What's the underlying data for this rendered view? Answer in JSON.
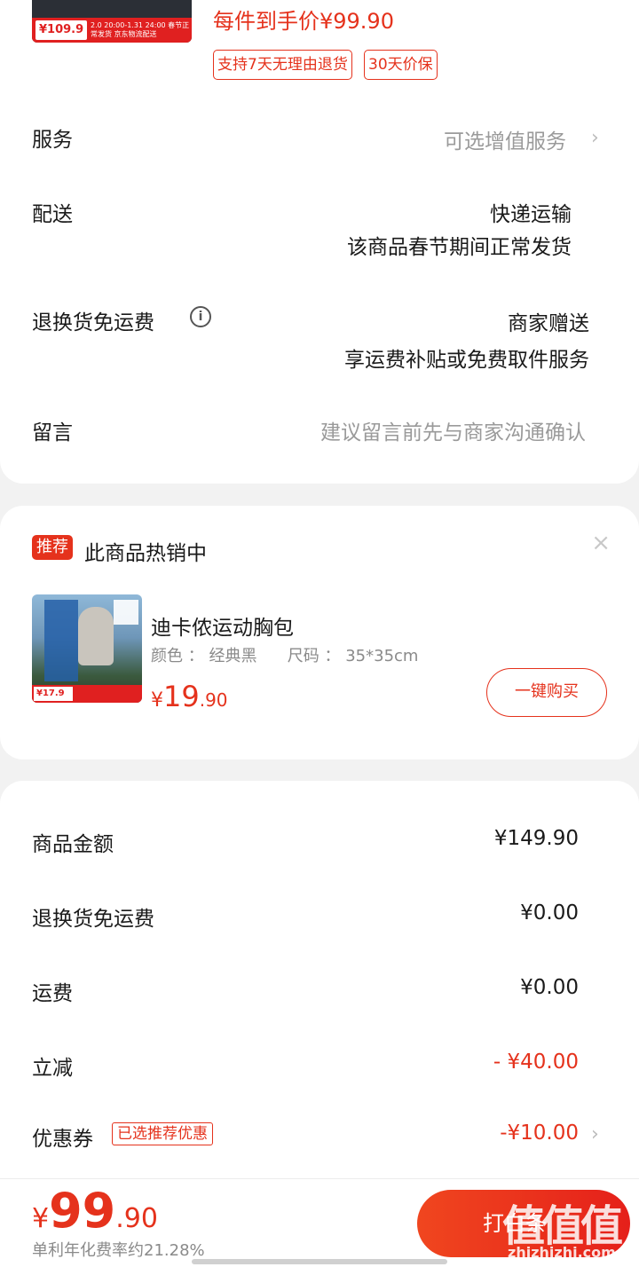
{
  "top": {
    "thumb_price": "109.9",
    "thumb_promo": "2.0 20:00-1.31 24:00 春节正常发货 京东物流配送",
    "unit_price": "每件到手价¥99.90",
    "tags": [
      "支持7天无理由退货",
      "30天价保"
    ]
  },
  "service": {
    "label": "服务",
    "value": "可选增值服务"
  },
  "delivery": {
    "label": "配送",
    "line1": "快递运输",
    "line2": "该商品春节期间正常发货"
  },
  "return_freight": {
    "label": "退换货免运费",
    "info_icon": "i",
    "line1": "商家赠送",
    "line2": "享运费补贴或免费取件服务"
  },
  "message": {
    "label": "留言",
    "placeholder": "建议留言前先与商家沟通确认"
  },
  "recommend": {
    "badge": "推荐",
    "title": "此商品热销中",
    "close": "×",
    "product": {
      "thumb_price": "17.9",
      "name": "迪卡侬运动胸包",
      "spec": "颜色 ： 经典黑      尺码 ： 35*35cm",
      "price_currency": "¥",
      "price_int": "19",
      "price_dec": ".90",
      "buy_label": "一键购买"
    }
  },
  "summary": {
    "rows": [
      {
        "label": "商品金额",
        "value": "¥149.90"
      },
      {
        "label": "退换货免运费",
        "value": "¥0.00"
      },
      {
        "label": "运费",
        "value": "¥0.00"
      },
      {
        "label": "立减",
        "value": "- ¥40.00"
      },
      {
        "label": "优惠券",
        "tag": "已选推荐优惠",
        "value": "-¥10.00"
      }
    ]
  },
  "bottom": {
    "currency": "¥",
    "total_int": "99",
    "total_dec": ".90",
    "sub_text": "单利年化费率约21.28%",
    "submit_label": "打白条",
    "watermark": "值值值",
    "watermark_url": "zhizhizhi.com"
  },
  "colors": {
    "accent": "#e5321c",
    "muted": "#9a9a9a",
    "background": "#f2f2f2"
  }
}
